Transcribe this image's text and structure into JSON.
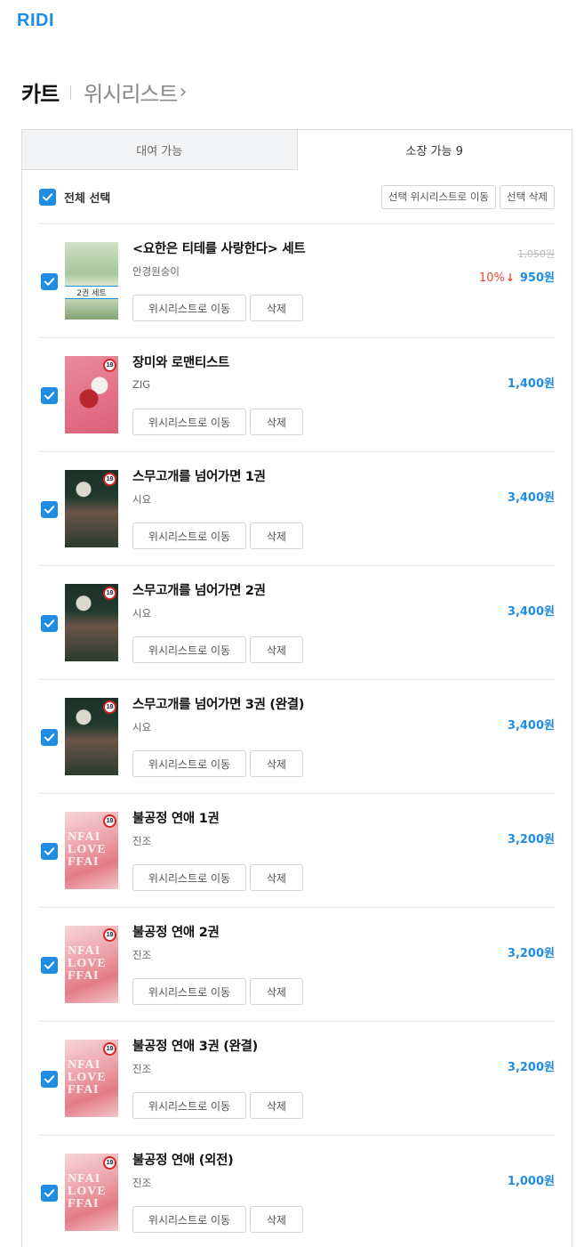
{
  "logo": "RIDI",
  "header": {
    "cart": "카트",
    "wishlist": "위시리스트",
    "wishlist_chevron": "›"
  },
  "tabs": [
    {
      "label": "대여 가능",
      "active": false
    },
    {
      "label": "소장 가능 9",
      "active": true
    }
  ],
  "toolbar": {
    "select_all": "전체 선택",
    "move_selected": "선택 위시리스트로 이동",
    "delete_selected": "선택 삭제"
  },
  "actions": {
    "move_wishlist": "위시리스트로 이동",
    "delete": "삭제"
  },
  "colors": {
    "accent": "#1f8ce6",
    "discount": "#e64938"
  },
  "items": [
    {
      "title": "<요한은 티테를 사랑한다> 세트",
      "author": "안경원숭이",
      "original_price": "1,050원",
      "discount_rate": "10%",
      "discount_arrow": "↓",
      "price": "950원",
      "set_badge": "2권 세트",
      "checked": true
    },
    {
      "title": "장미와 로맨티스트",
      "author": "ZIG",
      "price": "1,400원",
      "badge": "19",
      "checked": true
    },
    {
      "title": "스무고개를 넘어가면 1권",
      "author": "시요",
      "price": "3,400원",
      "badge": "19",
      "checked": true
    },
    {
      "title": "스무고개를 넘어가면 2권",
      "author": "시요",
      "price": "3,400원",
      "badge": "19",
      "checked": true
    },
    {
      "title": "스무고개를 넘어가면 3권 (완결)",
      "author": "시요",
      "price": "3,400원",
      "badge": "19",
      "checked": true
    },
    {
      "title": "불공정 연애 1권",
      "author": "진조",
      "price": "3,200원",
      "badge": "19",
      "cover_text": "NFAI LOVE FFAI",
      "checked": true
    },
    {
      "title": "불공정 연애 2권",
      "author": "진조",
      "price": "3,200원",
      "badge": "19",
      "cover_text": "NFAI LOVE FFAI",
      "checked": true
    },
    {
      "title": "불공정 연애 3권 (완결)",
      "author": "진조",
      "price": "3,200원",
      "badge": "19",
      "cover_text": "NFAI LOVE FFAI",
      "checked": true
    },
    {
      "title": "불공정 연애 (외전)",
      "author": "진조",
      "price": "1,000원",
      "badge": "19",
      "cover_text": "NFAI LOVE FFAI",
      "checked": true
    }
  ]
}
